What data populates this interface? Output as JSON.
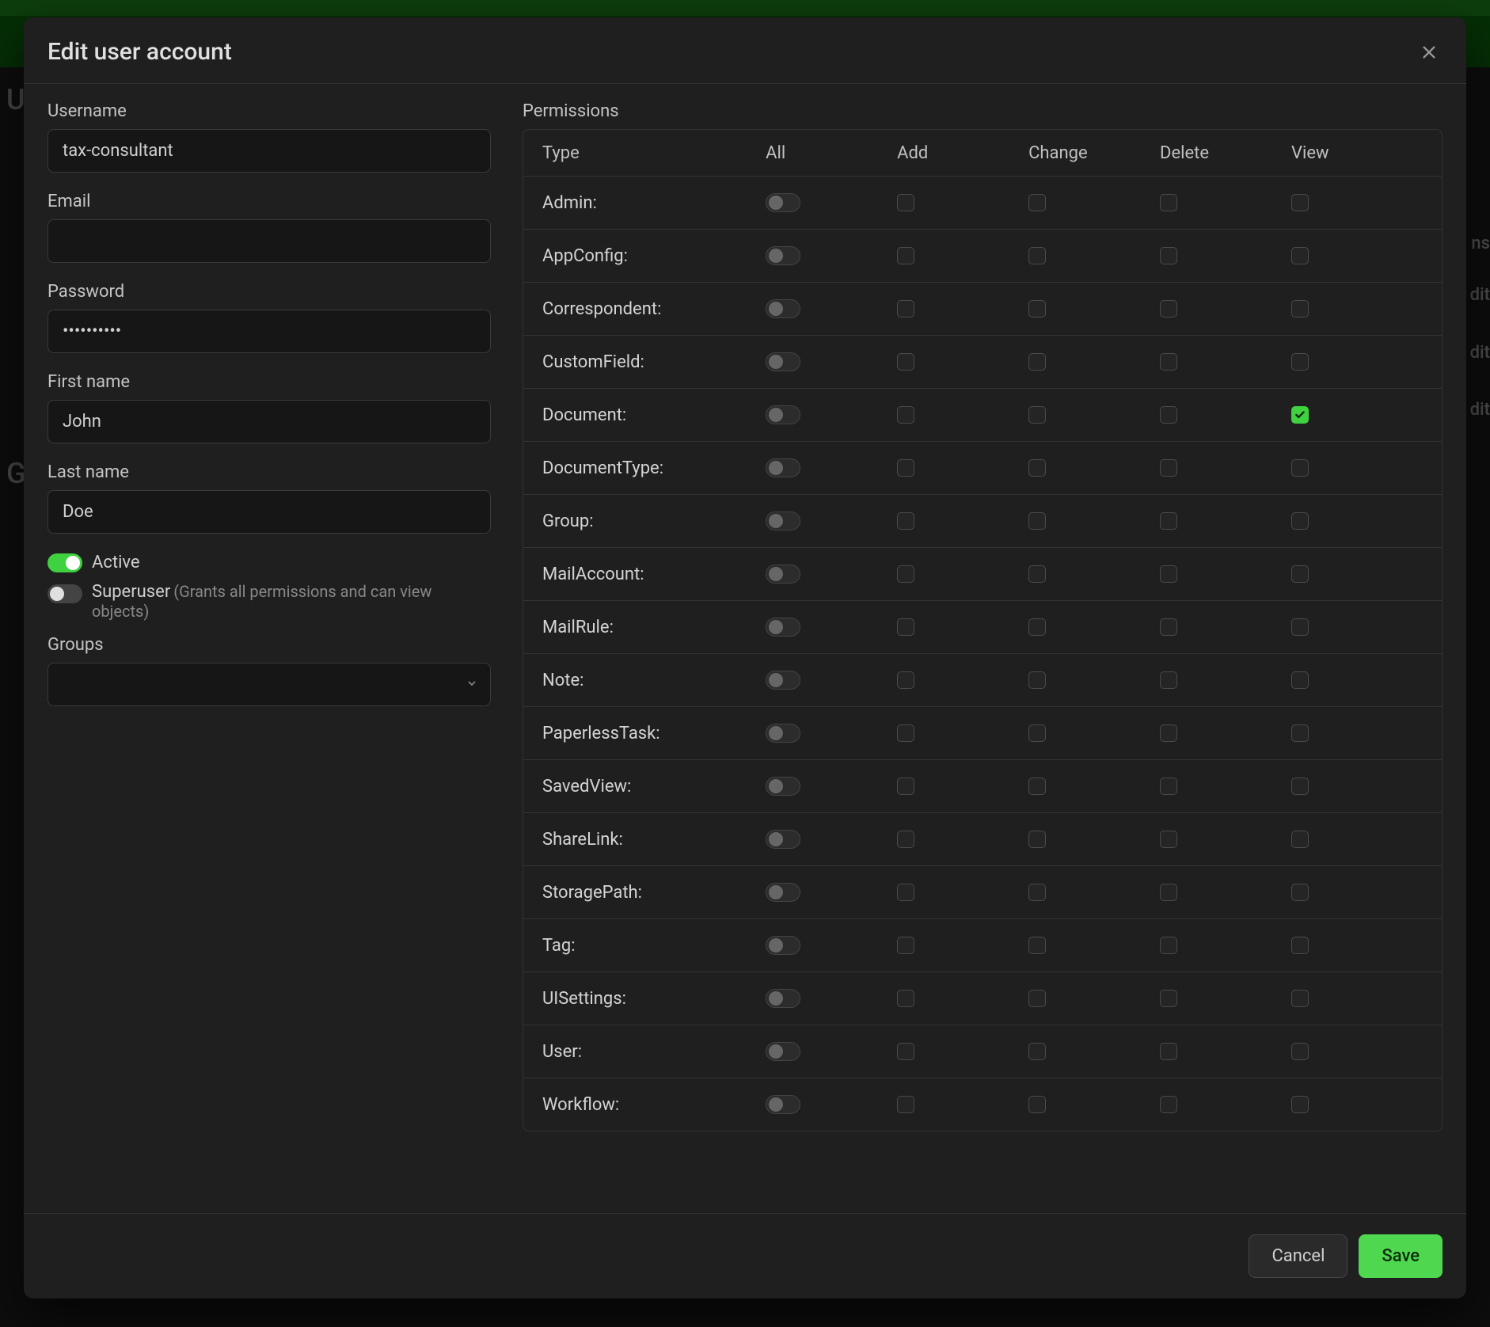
{
  "modal": {
    "title": "Edit user account"
  },
  "form": {
    "username_label": "Username",
    "username_value": "tax-consultant",
    "email_label": "Email",
    "email_value": "",
    "password_label": "Password",
    "password_value": "••••••••••",
    "firstname_label": "First name",
    "firstname_value": "John",
    "lastname_label": "Last name",
    "lastname_value": "Doe",
    "active_label": "Active",
    "active_on": true,
    "superuser_label": "Superuser",
    "superuser_hint_a": "(Grants all permissions and can view",
    "superuser_hint_b": "objects)",
    "superuser_on": false,
    "groups_label": "Groups"
  },
  "permissions": {
    "section_label": "Permissions",
    "headers": {
      "type": "Type",
      "all": "All",
      "add": "Add",
      "change": "Change",
      "delete": "Delete",
      "view": "View"
    },
    "rows": [
      {
        "label": "Admin:",
        "view": false
      },
      {
        "label": "AppConfig:",
        "view": false
      },
      {
        "label": "Correspondent:",
        "view": false
      },
      {
        "label": "CustomField:",
        "view": false
      },
      {
        "label": "Document:",
        "view": true
      },
      {
        "label": "DocumentType:",
        "view": false
      },
      {
        "label": "Group:",
        "view": false
      },
      {
        "label": "MailAccount:",
        "view": false
      },
      {
        "label": "MailRule:",
        "view": false
      },
      {
        "label": "Note:",
        "view": false
      },
      {
        "label": "PaperlessTask:",
        "view": false
      },
      {
        "label": "SavedView:",
        "view": false
      },
      {
        "label": "ShareLink:",
        "view": false
      },
      {
        "label": "StoragePath:",
        "view": false
      },
      {
        "label": "Tag:",
        "view": false
      },
      {
        "label": "UISettings:",
        "view": false
      },
      {
        "label": "User:",
        "view": false
      },
      {
        "label": "Workflow:",
        "view": false
      }
    ]
  },
  "footer": {
    "cancel": "Cancel",
    "save": "Save"
  },
  "background": {
    "text1": "U",
    "text2": "G",
    "frag_ns": "ns",
    "frag_dit": "dit"
  }
}
